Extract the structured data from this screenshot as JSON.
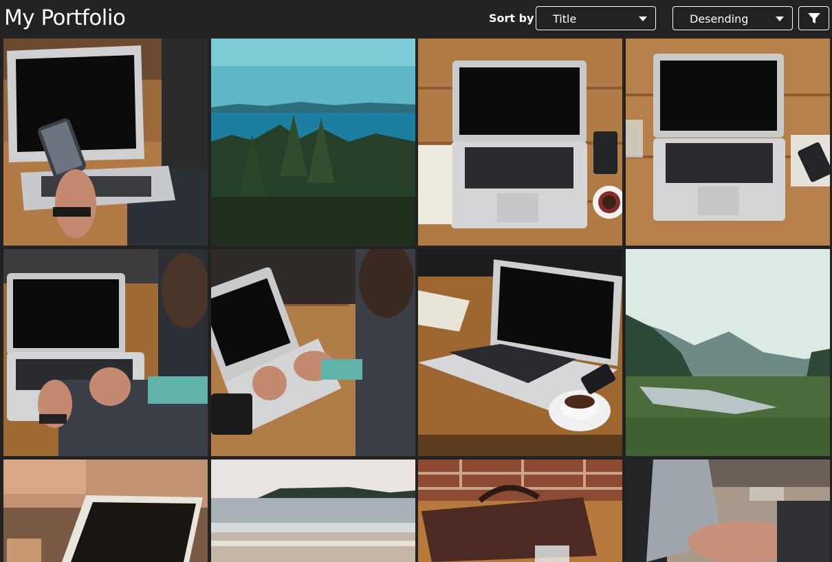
{
  "header": {
    "title": "My Portfolio",
    "sort_label": "Sort by",
    "sort_field": "Title",
    "sort_order": "Desending"
  },
  "icons": {
    "filter": "filter-icon",
    "dropdown": "chevron-down-icon"
  },
  "colors": {
    "background": "#222222",
    "text": "#ffffff"
  },
  "gallery": {
    "items": [
      {
        "subject": "laptop-hand-phone"
      },
      {
        "subject": "forest-lake"
      },
      {
        "subject": "laptop-desk-topdown"
      },
      {
        "subject": "laptop-desk-topdown-2"
      },
      {
        "subject": "man-typing-laptop"
      },
      {
        "subject": "man-laptop-outdoor"
      },
      {
        "subject": "laptop-coffee-notebook"
      },
      {
        "subject": "misty-river-valley"
      },
      {
        "subject": "laptop-blurred"
      },
      {
        "subject": "beach-island"
      },
      {
        "subject": "leather-bag-brick"
      },
      {
        "subject": "hands-laptop-blurred"
      }
    ]
  }
}
